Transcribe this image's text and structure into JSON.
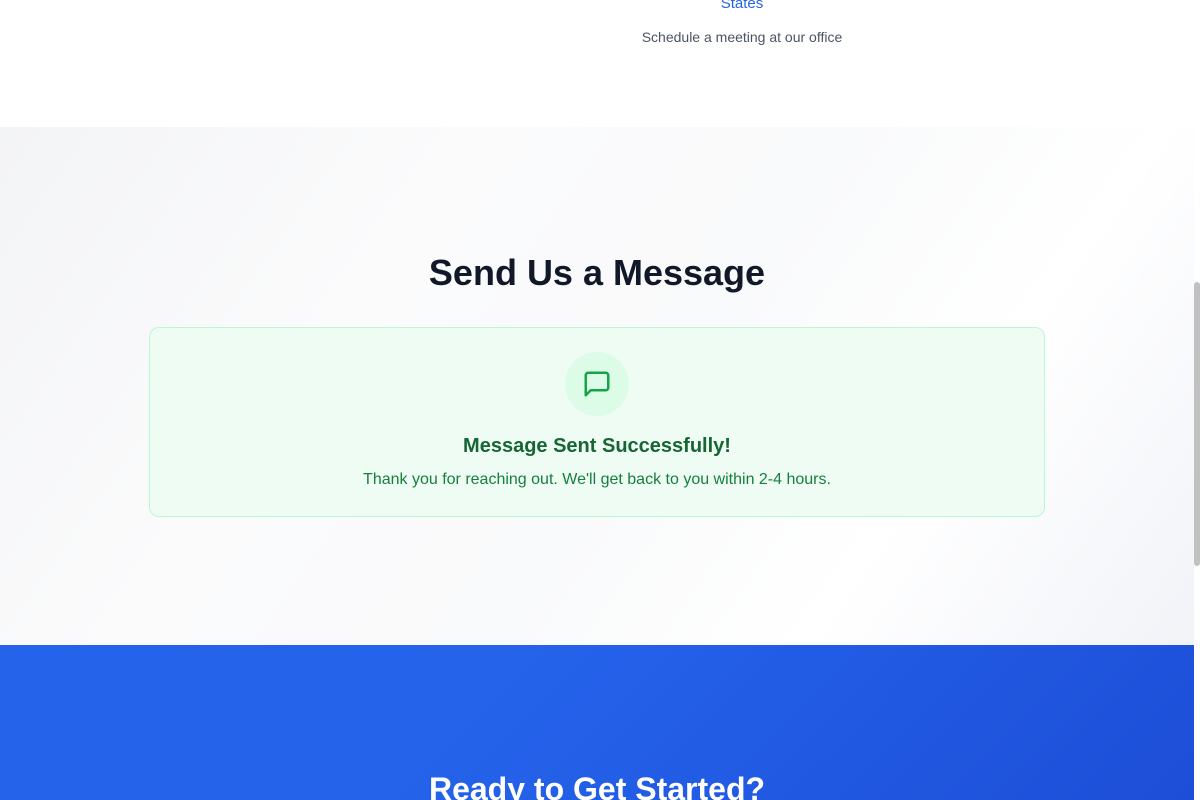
{
  "office": {
    "link_text": "States",
    "description": "Schedule a meeting at our office"
  },
  "message_section": {
    "title": "Send Us a Message",
    "success": {
      "icon": "message-square-icon",
      "title": "Message Sent Successfully!",
      "text": "Thank you for reaching out. We'll get back to you within 2-4 hours."
    }
  },
  "cta": {
    "title": "Ready to Get Started?"
  },
  "colors": {
    "accent": "#2563eb",
    "success_bg": "#effcf3",
    "success_border": "#bbf7d0",
    "success_title": "#166534",
    "success_text": "#15803d",
    "heading": "#111827"
  }
}
